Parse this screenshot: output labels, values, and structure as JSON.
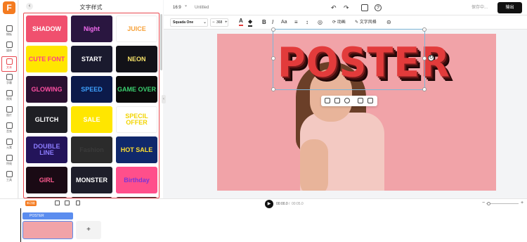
{
  "rail": {
    "items": [
      {
        "label": "模板",
        "name": "rail-item-templates"
      },
      {
        "label": "媒体",
        "name": "rail-item-media"
      },
      {
        "label": "文本",
        "name": "rail-item-text",
        "active": true
      },
      {
        "label": "字幕",
        "name": "rail-item-subtitles"
      },
      {
        "label": "视频",
        "name": "rail-item-video"
      },
      {
        "label": "图片",
        "name": "rail-item-images"
      },
      {
        "label": "音频",
        "name": "rail-item-audio"
      },
      {
        "label": "元素",
        "name": "rail-item-elements"
      },
      {
        "label": "特效",
        "name": "rail-item-effects"
      },
      {
        "label": "工具",
        "name": "rail-item-tools"
      }
    ],
    "logo": "F"
  },
  "panel": {
    "title": "文字样式",
    "tiles": [
      {
        "text": "SHADOW",
        "bg": "#f0506e",
        "fg": "#ffffff"
      },
      {
        "text": "Night",
        "bg": "#2a1640",
        "fg": "#f36bf0"
      },
      {
        "text": "JUICE",
        "bg": "#ffffff",
        "fg": "#f7a23b"
      },
      {
        "text": "CUTE FONT",
        "bg": "#ffe600",
        "fg": "#ff3c8a"
      },
      {
        "text": "START",
        "bg": "#1a1a2e",
        "fg": "#ffffff"
      },
      {
        "text": "NEON",
        "bg": "#121218",
        "fg": "#f8e46a"
      },
      {
        "text": "GLOWING",
        "bg": "#2a1030",
        "fg": "#ff4fa3"
      },
      {
        "text": "SPEED",
        "bg": "#0c1a4a",
        "fg": "#3da0ff"
      },
      {
        "text": "GAME OVER",
        "bg": "#0b0b0b",
        "fg": "#3bd16f"
      },
      {
        "text": "GLITCH",
        "bg": "#1f1f24",
        "fg": "#ffffff"
      },
      {
        "text": "SALE",
        "bg": "#ffe600",
        "fg": "#ffffff"
      },
      {
        "text": "SPECIL OFFER",
        "bg": "#ffffff",
        "fg": "#f2d400"
      },
      {
        "text": "DOUBLE LINE",
        "bg": "#23145a",
        "fg": "#8c7cff"
      },
      {
        "text": "Fashion",
        "bg": "#2b2b2b",
        "fg": "#3a3a3a"
      },
      {
        "text": "HOT SALE",
        "bg": "#10286b",
        "fg": "#ffde2f"
      },
      {
        "text": "GIRL",
        "bg": "#1a0a14",
        "fg": "#ff5a8f"
      },
      {
        "text": "MONSTER",
        "bg": "#1e1e2a",
        "fg": "#ffffff"
      },
      {
        "text": "Birthday",
        "bg": "#ff4f8b",
        "fg": "#7a35d9"
      }
    ]
  },
  "topbar": {
    "ratio": "16:9",
    "ratio_caret": "⌄",
    "doc_title": "Untitled",
    "saving": "保存中...",
    "export_label": "输出"
  },
  "toolbar": {
    "font": "Squada One",
    "size": "368",
    "animation": "动画",
    "text_style": "文字风格"
  },
  "canvas": {
    "headline": "POSTER",
    "bg_color": "#f1a3a8"
  },
  "playback": {
    "current": "00:00.0",
    "total": "00:05.0",
    "separator": "/"
  },
  "timeline": {
    "track_label": "POSTER",
    "add_label": "+",
    "tag": "新功能"
  }
}
